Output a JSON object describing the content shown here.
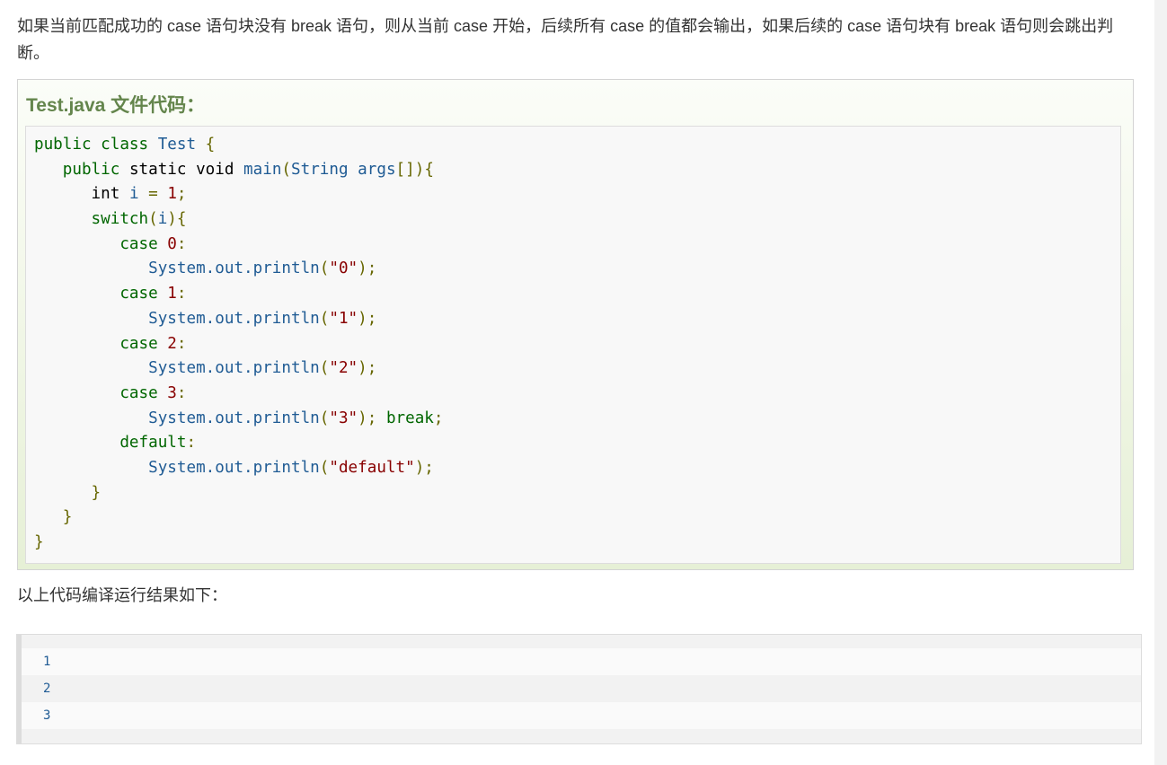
{
  "intro_text": "如果当前匹配成功的 case 语句块没有 break 语句，则从当前 case 开始，后续所有 case 的值都会输出，如果后续的 case 语句块有 break 语句则会跳出判断。",
  "example": {
    "title": "Test.java 文件代码：",
    "code_lines": [
      [
        {
          "t": "public class ",
          "c": "kw"
        },
        {
          "t": "Test ",
          "c": "cl"
        },
        {
          "t": "{",
          "c": "pn"
        }
      ],
      [
        {
          "t": "   public ",
          "c": "kw"
        },
        {
          "t": "static void ",
          "c": "ty"
        },
        {
          "t": "main",
          "c": "fn"
        },
        {
          "t": "(",
          "c": "pn"
        },
        {
          "t": "String args",
          "c": "cl"
        },
        {
          "t": "[]){",
          "c": "pn"
        }
      ],
      [
        {
          "t": "      int ",
          "c": "ty"
        },
        {
          "t": "i ",
          "c": "cl"
        },
        {
          "t": "= ",
          "c": "pn"
        },
        {
          "t": "1",
          "c": "num"
        },
        {
          "t": ";",
          "c": "pn"
        }
      ],
      [
        {
          "t": "      switch",
          "c": "kw"
        },
        {
          "t": "(",
          "c": "pn"
        },
        {
          "t": "i",
          "c": "cl"
        },
        {
          "t": "){",
          "c": "pn"
        }
      ],
      [
        {
          "t": "         case ",
          "c": "kw"
        },
        {
          "t": "0",
          "c": "num"
        },
        {
          "t": ":",
          "c": "pn"
        }
      ],
      [
        {
          "t": "            System.out.println",
          "c": "fn"
        },
        {
          "t": "(",
          "c": "pn"
        },
        {
          "t": "\"0\"",
          "c": "str"
        },
        {
          "t": ");",
          "c": "pn"
        }
      ],
      [
        {
          "t": "         case ",
          "c": "kw"
        },
        {
          "t": "1",
          "c": "num"
        },
        {
          "t": ":",
          "c": "pn"
        }
      ],
      [
        {
          "t": "            System.out.println",
          "c": "fn"
        },
        {
          "t": "(",
          "c": "pn"
        },
        {
          "t": "\"1\"",
          "c": "str"
        },
        {
          "t": ");",
          "c": "pn"
        }
      ],
      [
        {
          "t": "         case ",
          "c": "kw"
        },
        {
          "t": "2",
          "c": "num"
        },
        {
          "t": ":",
          "c": "pn"
        }
      ],
      [
        {
          "t": "            System.out.println",
          "c": "fn"
        },
        {
          "t": "(",
          "c": "pn"
        },
        {
          "t": "\"2\"",
          "c": "str"
        },
        {
          "t": ");",
          "c": "pn"
        }
      ],
      [
        {
          "t": "         case ",
          "c": "kw"
        },
        {
          "t": "3",
          "c": "num"
        },
        {
          "t": ":",
          "c": "pn"
        }
      ],
      [
        {
          "t": "            System.out.println",
          "c": "fn"
        },
        {
          "t": "(",
          "c": "pn"
        },
        {
          "t": "\"3\"",
          "c": "str"
        },
        {
          "t": "); ",
          "c": "pn"
        },
        {
          "t": "break",
          "c": "kw"
        },
        {
          "t": ";",
          "c": "pn"
        }
      ],
      [
        {
          "t": "         default",
          "c": "kw"
        },
        {
          "t": ":",
          "c": "pn"
        }
      ],
      [
        {
          "t": "            System.out.println",
          "c": "fn"
        },
        {
          "t": "(",
          "c": "pn"
        },
        {
          "t": "\"default\"",
          "c": "str"
        },
        {
          "t": ");",
          "c": "pn"
        }
      ],
      [
        {
          "t": "      }",
          "c": "pn"
        }
      ],
      [
        {
          "t": "   }",
          "c": "pn"
        }
      ],
      [
        {
          "t": "}",
          "c": "pn"
        }
      ]
    ]
  },
  "result_label": "以上代码编译运行结果如下：",
  "output_lines": [
    "1",
    "2",
    "3"
  ]
}
